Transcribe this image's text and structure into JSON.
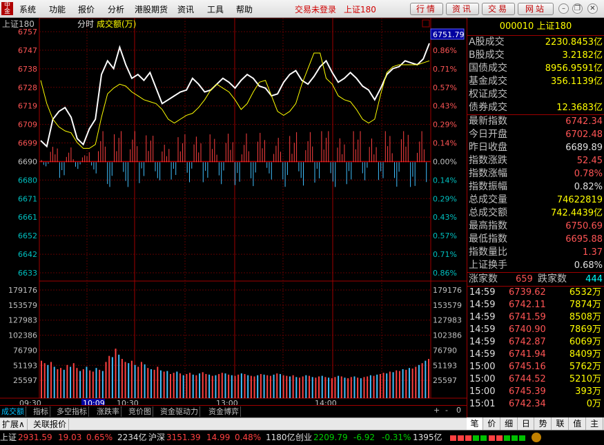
{
  "app": {
    "logo_text": "中金",
    "menu": [
      "系统",
      "功能",
      "报价",
      "分析",
      "港股期货",
      "资讯",
      "工具",
      "帮助"
    ],
    "status_text": "交易未登录",
    "status_index": "上证180",
    "top_buttons": [
      "行情",
      "资讯",
      "交易",
      "网站"
    ],
    "window_controls": [
      "minimize-icon",
      "restore-icon",
      "close-icon"
    ]
  },
  "chart_header": {
    "index_name": "上证180",
    "mode": "分时",
    "indicator": "成交额(万)",
    "current_label": "6751.79"
  },
  "chart_data": [
    {
      "type": "line",
      "name": "intraday-price",
      "y_ticks_left": [
        "6757",
        "6747",
        "6738",
        "6728",
        "6719",
        "6709",
        "6699",
        "6690",
        "6680",
        "6671",
        "6661",
        "6652",
        "6642",
        "6633"
      ],
      "y_ticks_right": [
        "",
        "0.86%",
        "0.71%",
        "0.57%",
        "0.43%",
        "0.29%",
        "0.14%",
        "0.00%",
        "0.14%",
        "0.29%",
        "0.43%",
        "0.57%",
        "0.71%",
        "0.86%"
      ],
      "prev_close": 6689.89,
      "ylim": [
        6633,
        6757
      ],
      "x_ticks": [
        "09:30",
        "10:09",
        "10:30",
        "13:00",
        "14:00"
      ],
      "highlight_time": "10:09",
      "series": [
        {
          "name": "price",
          "color": "#ffffff",
          "values": [
            6701,
            6698,
            6712,
            6716,
            6718,
            6713,
            6702,
            6699,
            6707,
            6712,
            6735,
            6742,
            6738,
            6749,
            6740,
            6733,
            6735,
            6732,
            6736,
            6728,
            6720,
            6722,
            6724,
            6726,
            6727,
            6733,
            6730,
            6726,
            6727,
            6730,
            6733,
            6731,
            6728,
            6732,
            6735,
            6733,
            6729,
            6728,
            6724,
            6725,
            6731,
            6735,
            6737,
            6732,
            6730,
            6734,
            6739,
            6742,
            6736,
            6731,
            6733,
            6736,
            6733,
            6729,
            6727,
            6722,
            6728,
            6735,
            6738,
            6739,
            6742,
            6741,
            6740,
            6743,
            6751
          ]
        },
        {
          "name": "average",
          "color": "#ffff00",
          "values": [
            6732,
            6720,
            6712,
            6708,
            6706,
            6705,
            6700,
            6697,
            6697,
            6699,
            6713,
            6725,
            6728,
            6730,
            6729,
            6726,
            6724,
            6722,
            6721,
            6720,
            6717,
            6712,
            6710,
            6712,
            6714,
            6715,
            6718,
            6722,
            6727,
            6730,
            6728,
            6726,
            6722,
            6717,
            6720,
            6726,
            6731,
            6732,
            6724,
            6716,
            6714,
            6716,
            6720,
            6730,
            6738,
            6746,
            6746,
            6733,
            6730,
            6724,
            6722,
            6721,
            6717,
            6712,
            6710,
            6712,
            6725,
            6736,
            6739,
            6740,
            6740,
            6740,
            6740,
            6741,
            6742
          ]
        }
      ]
    },
    {
      "type": "bar",
      "name": "turnover",
      "y_ticks": [
        "179176",
        "153579",
        "127983",
        "102386",
        "76790",
        "51193",
        "25597"
      ],
      "ylim": [
        0,
        179176
      ],
      "values": [
        62000,
        58000,
        55000,
        60000,
        52000,
        48000,
        50000,
        47000,
        55000,
        52000,
        58000,
        50000,
        45000,
        48000,
        52000,
        46000,
        44000,
        50000,
        47000,
        45000,
        60000,
        70000,
        68000,
        82000,
        72000,
        65000,
        60000,
        58000,
        62000,
        55000,
        52000,
        60000,
        56000,
        50000,
        48000,
        47000,
        52000,
        46000,
        44000,
        45000,
        40000,
        42000,
        44000,
        41000,
        38000,
        40000,
        42000,
        39000,
        38000,
        41000,
        43000,
        40000,
        39000,
        37000,
        38000,
        40000,
        42000,
        41000,
        39000,
        38000,
        37000,
        39000,
        41000,
        40000,
        38000,
        37000,
        36000,
        38000,
        40000,
        39000,
        38000,
        37000,
        39000,
        41000,
        40000,
        38000,
        37000,
        36000,
        38000,
        35000,
        34000,
        36000,
        38000,
        37000,
        35000,
        34000,
        36000,
        37000,
        35000,
        34000,
        33000,
        35000,
        37000,
        36000,
        34000,
        33000,
        35000,
        36000,
        34000,
        33000,
        35000,
        36000,
        38000,
        37000,
        39000,
        40000,
        42000,
        41000,
        44000,
        43000,
        46000,
        45000,
        48000,
        47000,
        50000,
        49000,
        52000,
        55000,
        58000,
        62000,
        65000
      ]
    }
  ],
  "panel": {
    "title": "000010 上证180",
    "turnover_rows": [
      {
        "label": "A股成交",
        "value": "2230.8453亿"
      },
      {
        "label": "B股成交",
        "value": "3.2182亿"
      },
      {
        "label": "国债成交",
        "value": "8956.9591亿"
      },
      {
        "label": "基金成交",
        "value": "356.1139亿"
      },
      {
        "label": "权证成交",
        "value": ""
      },
      {
        "label": "债券成交",
        "value": "12.3683亿"
      }
    ],
    "index_rows": [
      {
        "label": "最新指数",
        "value": "6742.34",
        "color": "#ff5555"
      },
      {
        "label": "今日开盘",
        "value": "6702.48",
        "color": "#ff5555"
      },
      {
        "label": "昨日收盘",
        "value": "6689.89",
        "color": "#e0e0e0"
      },
      {
        "label": "指数涨跌",
        "value": "52.45",
        "color": "#ff5555"
      },
      {
        "label": "指数涨幅",
        "value": "0.78%",
        "color": "#ff5555"
      },
      {
        "label": "指数振幅",
        "value": "0.82%",
        "color": "#e0e0e0"
      },
      {
        "label": "总成交量",
        "value": "74622819",
        "color": "#ffff00"
      },
      {
        "label": "总成交额",
        "value": "742.4439亿",
        "color": "#ffff00"
      },
      {
        "label": "最高指数",
        "value": "6750.69",
        "color": "#ff5555"
      },
      {
        "label": "最低指数",
        "value": "6695.88",
        "color": "#ff5555"
      },
      {
        "label": "指数量比",
        "value": "1.37",
        "color": "#ff5555"
      },
      {
        "label": "上证换手",
        "value": "0.68%",
        "color": "#e0e0e0"
      }
    ],
    "advance_label": "涨家数",
    "advance_value": "659",
    "decline_label": "跌家数",
    "decline_value": "444",
    "ticks": [
      {
        "time": "14:59",
        "price": "6739.62",
        "vol": "6532万"
      },
      {
        "time": "14:59",
        "price": "6742.11",
        "vol": "7874万"
      },
      {
        "time": "14:59",
        "price": "6741.59",
        "vol": "8508万"
      },
      {
        "time": "14:59",
        "price": "6740.90",
        "vol": "7869万"
      },
      {
        "time": "14:59",
        "price": "6742.87",
        "vol": "6069万"
      },
      {
        "time": "14:59",
        "price": "6741.94",
        "vol": "8409万"
      },
      {
        "time": "15:00",
        "price": "6745.16",
        "vol": "5762万"
      },
      {
        "time": "15:00",
        "price": "6744.52",
        "vol": "5210万"
      },
      {
        "time": "15:00",
        "price": "6745.39",
        "vol": "393万"
      },
      {
        "time": "15:01",
        "price": "6742.34",
        "vol": "0万"
      }
    ]
  },
  "chart_tabs": [
    "成交额",
    "指标",
    "多空指标",
    "涨跌率",
    "竞价图",
    "资金驱动力",
    "资金博弈"
  ],
  "scroll_controls": [
    "+",
    "-",
    "0"
  ],
  "sub_tabs": [
    "扩展∧",
    "关联报价"
  ],
  "panel_tabs": [
    "笔",
    "价",
    "细",
    "日",
    "势",
    "联",
    "值",
    "主"
  ],
  "statusbar": [
    {
      "name": "上证",
      "price": "2931.59",
      "chg": "19.03",
      "pct": "0.65%",
      "amt": "2234亿",
      "dir": "up"
    },
    {
      "name": "沪深",
      "price": "3151.39",
      "chg": "14.99",
      "pct": "0.48%",
      "amt": "1180亿",
      "dir": "up"
    },
    {
      "name": "创业",
      "price": "2209.79",
      "chg": "-6.92",
      "pct": "-0.31%",
      "amt": "1395亿",
      "dir": "down"
    }
  ]
}
